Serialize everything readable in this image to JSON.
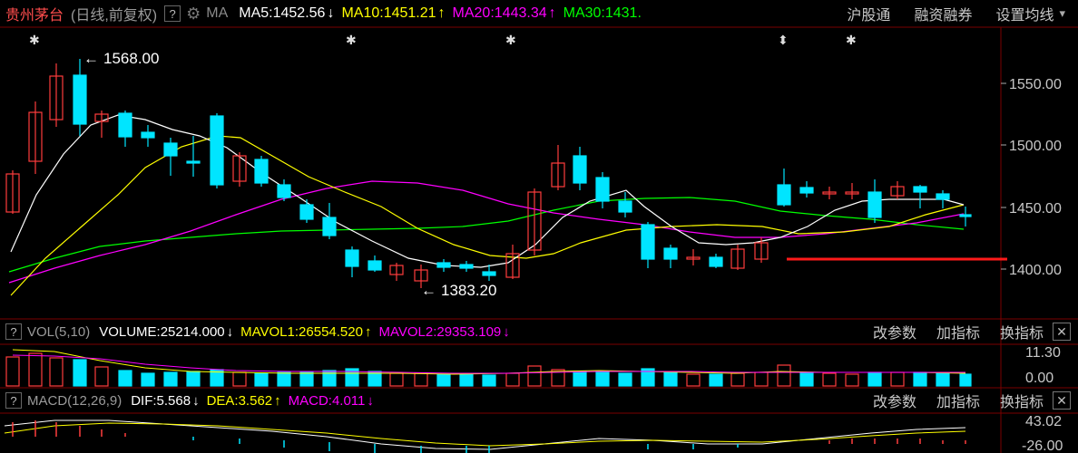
{
  "header": {
    "stock_name": "贵州茅台",
    "chart_mode": "(日线,前复权)",
    "help": "?",
    "ma_label": "MA",
    "ma5": "MA5:1452.56",
    "ma10": "MA10:1451.21",
    "ma20": "MA20:1443.34",
    "ma30": "MA30:1431.",
    "arrow_down": "↓",
    "arrow_up": "↑",
    "link_hsgt": "沪股通",
    "link_margin": "融资融券",
    "link_settings": "设置均线",
    "dropdown": "▾"
  },
  "price_axis": [
    "1550.00",
    "1500.00",
    "1450.00",
    "1400.00"
  ],
  "annotations": {
    "high": "1568.00",
    "low": "1383.20",
    "arrow_left": "←"
  },
  "volume_panel": {
    "help": "?",
    "indicator": "VOL(5,10)",
    "volume": "VOLUME:25214.000",
    "mavol1": "MAVOL1:26554.520",
    "mavol2": "MAVOL2:29353.109",
    "axis": [
      "11.30",
      "0.00"
    ]
  },
  "macd_panel": {
    "help": "?",
    "indicator": "MACD(12,26,9)",
    "dif": "DIF:5.568",
    "dea": "DEA:3.562",
    "macd": "MACD:4.011",
    "axis": [
      "43.02",
      "-26.00"
    ]
  },
  "panel_buttons": {
    "params": "改参数",
    "add": "加指标",
    "switch": "换指标",
    "close": "✕"
  },
  "colors": {
    "bg": "#000000",
    "up": "#ff3d3d",
    "down": "#00e5ff",
    "ma5": "#ffffff",
    "ma10": "#ffff00",
    "ma20": "#ff00ff",
    "ma30": "#00ff00",
    "header_red": "#ff4d4d"
  }
}
